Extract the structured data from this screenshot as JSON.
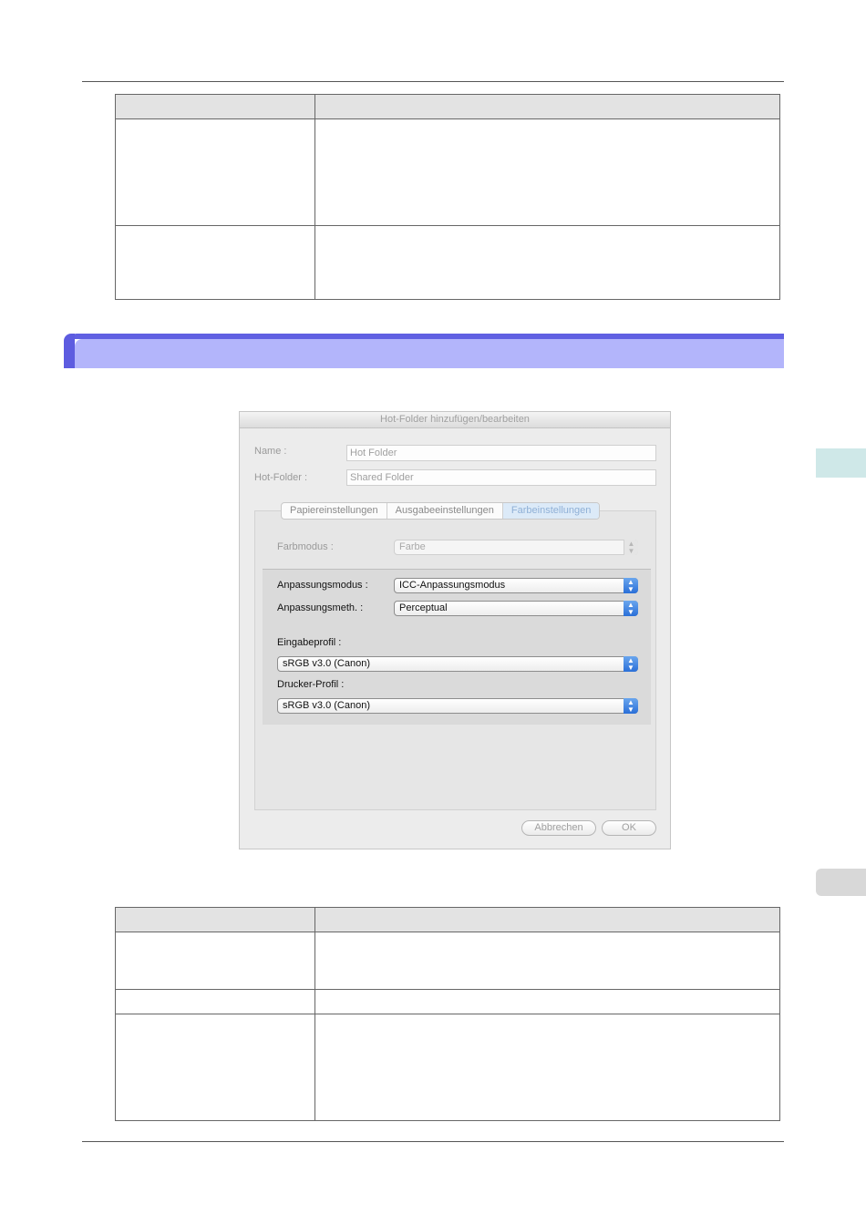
{
  "dialog": {
    "title": "Hot-Folder hinzufügen/bearbeiten",
    "name_label": "Name :",
    "name_value": "Hot Folder",
    "hotfolder_label": "Hot-Folder :",
    "hotfolder_value": "Shared Folder",
    "tabs": [
      "Papiereinstellungen",
      "Ausgabeeinstellungen",
      "Farbeinstellungen"
    ],
    "active_tab": "Farbeinstellungen",
    "farbmodus_label": "Farbmodus :",
    "farbmodus_value": "Farbe",
    "anpassungsmodus_label": "Anpassungsmodus :",
    "anpassungsmodus_value": "ICC-Anpassungsmodus",
    "anpassungsmeth_label": "Anpassungsmeth. :",
    "anpassungsmeth_value": "Perceptual",
    "eingabeprofil_label": "Eingabeprofil :",
    "eingabeprofil_value": "sRGB v3.0 (Canon)",
    "druckerprofil_label": "Drucker-Profil :",
    "druckerprofil_value": "sRGB v3.0 (Canon)",
    "cancel_label": "Abbrechen",
    "ok_label": "OK"
  },
  "colors": {
    "heading_band": "#b3b5fb",
    "heading_accent": "#5d5ce0",
    "popup_arrow": "#2a6fd8",
    "table_header": "#e3e3e3"
  },
  "icons": {
    "popup_arrows": "up-down-arrows-icon"
  }
}
